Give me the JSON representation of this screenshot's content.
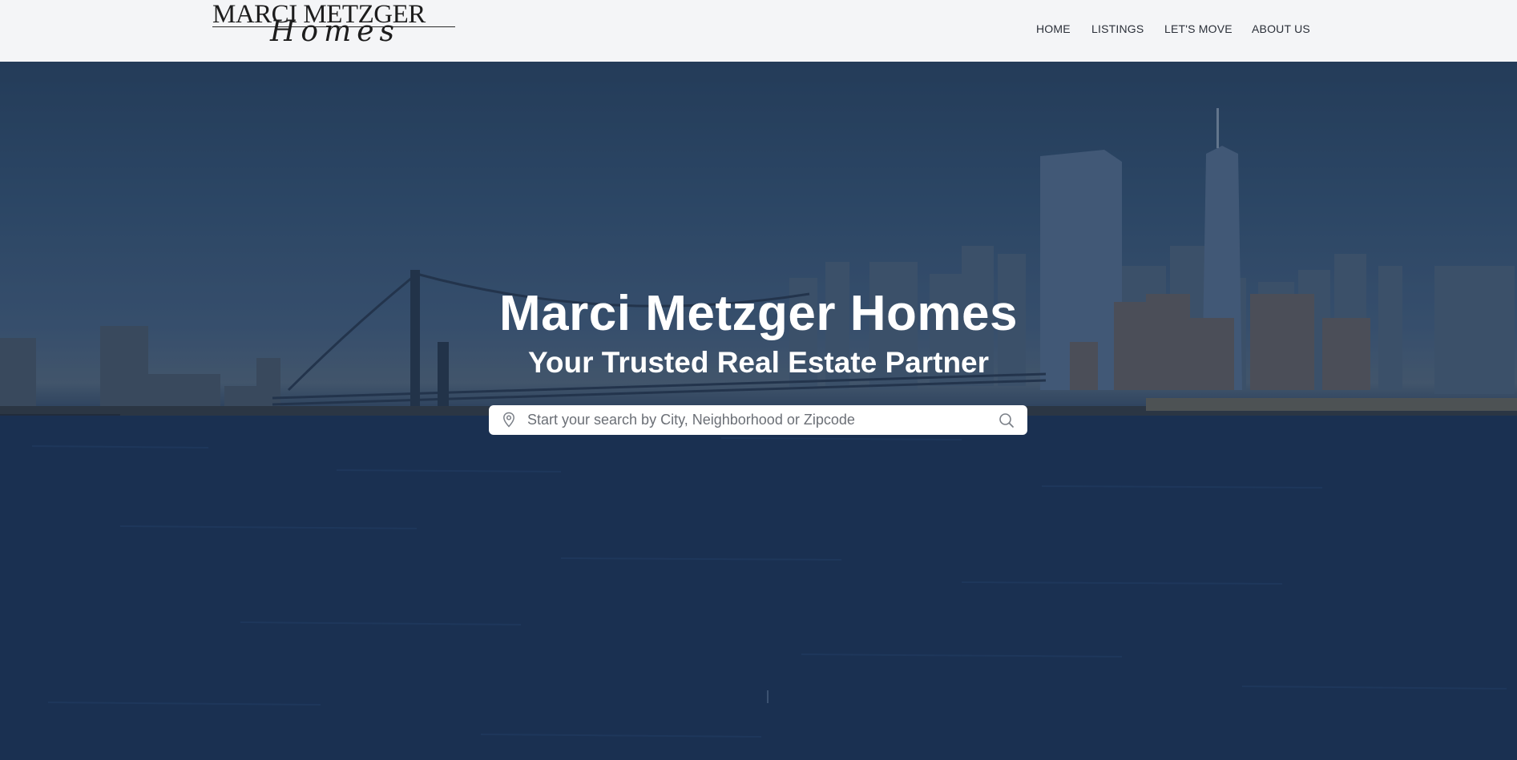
{
  "header": {
    "logo": {
      "top_text": "MARCI METZGER",
      "script_text": "Homes"
    },
    "nav": [
      {
        "label": "HOME"
      },
      {
        "label": "LISTINGS"
      },
      {
        "label": "LET'S MOVE"
      },
      {
        "label": "ABOUT US"
      }
    ]
  },
  "hero": {
    "background": "city-skyline-waterfront-image",
    "title": "Marci Metzger Homes",
    "subtitle": "Your Trusted Real Estate Partner",
    "search": {
      "placeholder": "Start your search by City, Neighborhood or Zipcode",
      "value": "",
      "left_icon": "map-pin-icon",
      "right_icon": "search-icon"
    }
  },
  "colors": {
    "header_bg": "#f4f5f7",
    "nav_text": "#2a2f38",
    "hero_overlay": "#1d3558",
    "search_bg": "#ffffff"
  }
}
